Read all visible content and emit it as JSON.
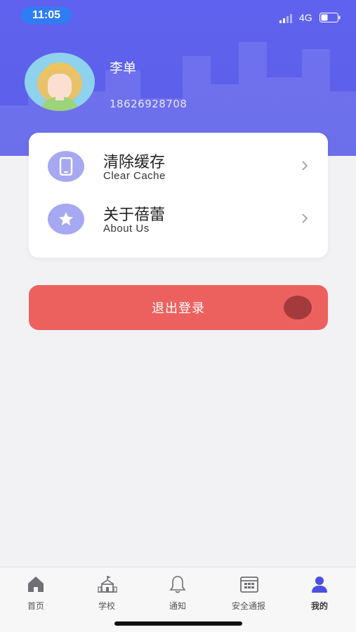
{
  "status_bar": {
    "time": "11:05",
    "network": "4G"
  },
  "profile": {
    "name": "李单",
    "phone": "18626928708"
  },
  "menu": [
    {
      "title": "清除缓存",
      "subtitle": "Clear Cache",
      "icon": "phone-icon"
    },
    {
      "title": "关于蓓蕾",
      "subtitle": "About Us",
      "icon": "star-icon"
    }
  ],
  "logout": {
    "label": "退出登录"
  },
  "tabbar": [
    {
      "label": "首页",
      "icon": "home-icon",
      "active": false
    },
    {
      "label": "学校",
      "icon": "school-icon",
      "active": false
    },
    {
      "label": "通知",
      "icon": "bell-icon",
      "active": false
    },
    {
      "label": "安全通报",
      "icon": "calendar-icon",
      "active": false
    },
    {
      "label": "我的",
      "icon": "user-icon",
      "active": true
    }
  ],
  "colors": {
    "header": "#5f62ee",
    "accent": "#4b4fe2",
    "logout": "#ec615e",
    "icon_bg": "#a6a8f2"
  }
}
